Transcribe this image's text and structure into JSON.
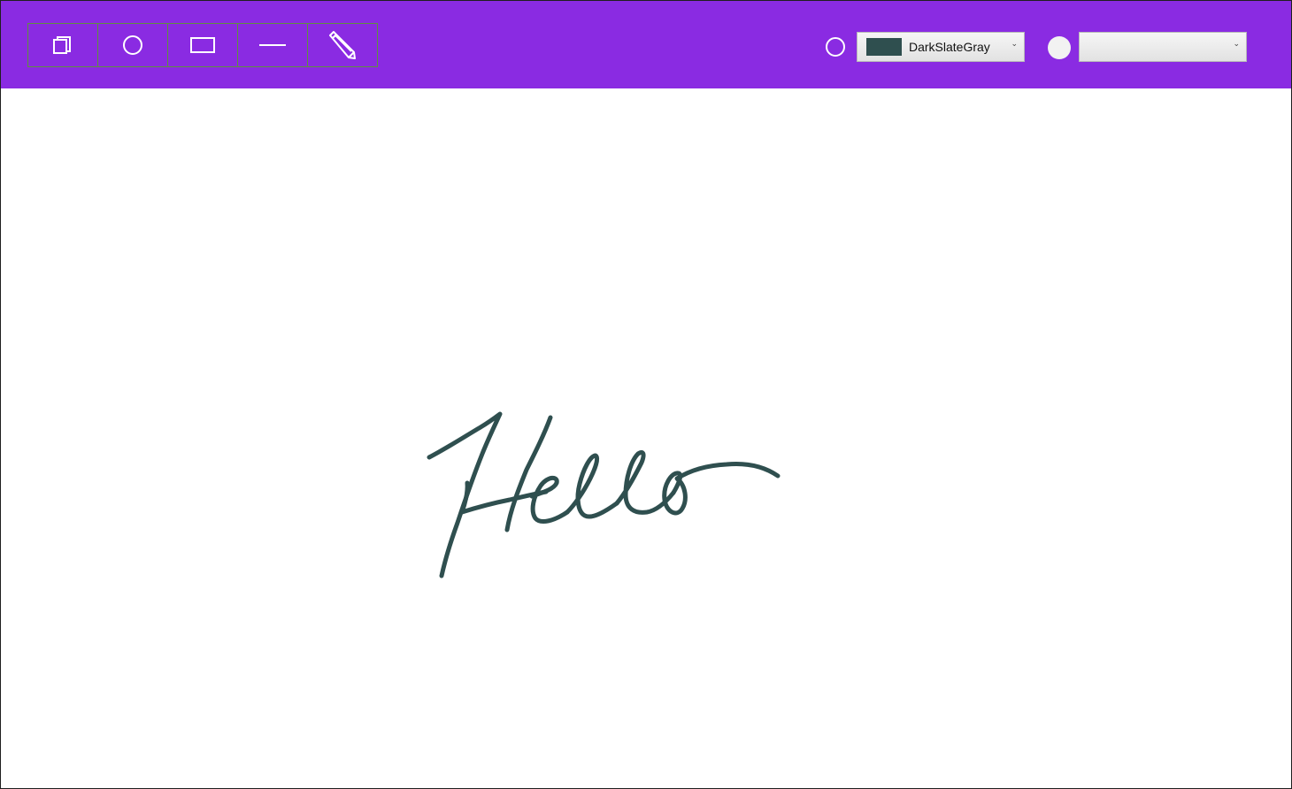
{
  "app": {
    "toolbar_color": "#8a2be2"
  },
  "tools": [
    {
      "name": "select-tool",
      "icon": "layers-icon"
    },
    {
      "name": "ellipse-tool",
      "icon": "circle-icon"
    },
    {
      "name": "rectangle-tool",
      "icon": "rectangle-icon"
    },
    {
      "name": "line-tool",
      "icon": "line-icon"
    },
    {
      "name": "pencil-tool",
      "icon": "pencil-icon"
    }
  ],
  "stroke": {
    "indicator_icon": "circle-outline-icon",
    "selected_label": "DarkSlateGray",
    "selected_color": "#2f4f4f"
  },
  "fill": {
    "indicator_icon": "circle-filled-icon",
    "selected_label": "",
    "indicator_color": "#f2f2f2"
  },
  "canvas": {
    "ink_color": "#2f4f4f",
    "handwriting_text": "Hello"
  }
}
